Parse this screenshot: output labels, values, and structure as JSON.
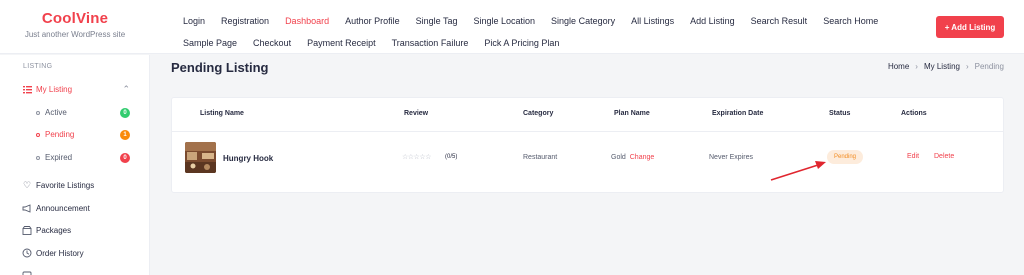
{
  "brand": {
    "title": "CoolVine",
    "tagline": "Just another WordPress site"
  },
  "nav": {
    "items": [
      "Login",
      "Registration",
      "Dashboard",
      "Author Profile",
      "Single Tag",
      "Single Location",
      "Single Category",
      "All Listings",
      "Add Listing",
      "Search Result",
      "Search Home",
      "Sample Page",
      "Checkout",
      "Payment Receipt",
      "Transaction Failure",
      "Pick A Pricing Plan"
    ],
    "active": "Dashboard"
  },
  "header": {
    "add_listing_label": "+ Add Listing"
  },
  "sidebar": {
    "heading": "LISTING",
    "my_listing": "My Listing",
    "sub": [
      {
        "label": "Active",
        "count": "0",
        "color": "#32cc6f"
      },
      {
        "label": "Pending",
        "count": "1",
        "color": "#fa8b0c"
      },
      {
        "label": "Expired",
        "count": "0",
        "color": "#f1414c"
      }
    ],
    "items": [
      "Favorite Listings",
      "Announcement",
      "Packages",
      "Order History"
    ]
  },
  "main": {
    "title": "Pending Listing",
    "breadcrumb": {
      "home": "Home",
      "section": "My Listing",
      "current": "Pending"
    }
  },
  "table": {
    "headers": {
      "listing_name": "Listing Name",
      "review": "Review",
      "category": "Category",
      "plan_name": "Plan Name",
      "expiration": "Expiration Date",
      "status": "Status",
      "actions": "Actions"
    },
    "row": {
      "name": "Hungry Hook",
      "stars": "☆☆☆☆☆",
      "review_count": "(0/5)",
      "category": "Restaurant",
      "plan": "Gold",
      "plan_change": "Change",
      "expiration": "Never Expires",
      "status": "Pending",
      "edit": "Edit",
      "delete": "Delete"
    }
  },
  "colors": {
    "accent": "#f1414c",
    "pending": "#f28c22"
  }
}
